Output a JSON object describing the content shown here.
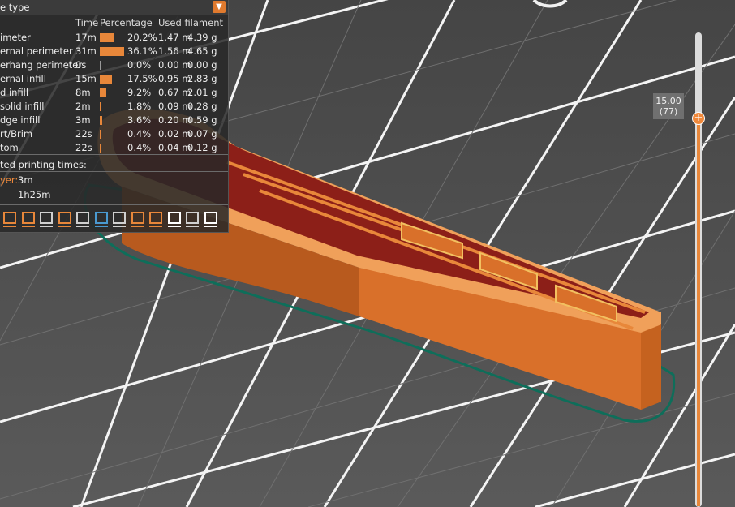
{
  "legend": {
    "title": "e type",
    "columns": {
      "time": "Time",
      "percentage": "Percentage",
      "used": "Used filament"
    },
    "rows": [
      {
        "name": "imeter",
        "time": "17m",
        "percent": 20.2,
        "percent_label": "20.2%",
        "length": "1.47 m",
        "weight": "4.39 g"
      },
      {
        "name": "ernal perimeter",
        "time": "31m",
        "percent": 36.1,
        "percent_label": "36.1%",
        "length": "1.56 m",
        "weight": "4.65 g"
      },
      {
        "name": "erhang perimeter",
        "time": "0s",
        "percent": 0.0,
        "percent_label": "0.0%",
        "length": "0.00 m",
        "weight": "0.00 g"
      },
      {
        "name": "ernal infill",
        "time": "15m",
        "percent": 17.5,
        "percent_label": "17.5%",
        "length": "0.95 m",
        "weight": "2.83 g"
      },
      {
        "name": "d infill",
        "time": "8m",
        "percent": 9.2,
        "percent_label": "9.2%",
        "length": "0.67 m",
        "weight": "2.01 g"
      },
      {
        "name": " solid infill",
        "time": "2m",
        "percent": 1.8,
        "percent_label": "1.8%",
        "length": "0.09 m",
        "weight": "0.28 g"
      },
      {
        "name": "dge infill",
        "time": "3m",
        "percent": 3.6,
        "percent_label": "3.6%",
        "length": "0.20 m",
        "weight": "0.59 g"
      },
      {
        "name": "rt/Brim",
        "time": "22s",
        "percent": 0.4,
        "percent_label": "0.4%",
        "length": "0.02 m",
        "weight": "0.07 g"
      },
      {
        "name": "tom",
        "time": "22s",
        "percent": 0.4,
        "percent_label": "0.4%",
        "length": "0.04 m",
        "weight": "0.12 g"
      }
    ],
    "estimated_title": "ted printing times:",
    "layer_label": "yer:",
    "layer_time": "3m",
    "total_time": "1h25m",
    "toolbar": [
      {
        "icon": "shell-icon",
        "color": "#e8873a"
      },
      {
        "icon": "overhang-icon",
        "color": "#e8873a"
      },
      {
        "icon": "wipe-icon",
        "color": "#d0d0d0"
      },
      {
        "icon": "seam-icon",
        "color": "#e8873a"
      },
      {
        "icon": "travel-icon",
        "color": "#d0d0d0"
      },
      {
        "icon": "color-change-icon",
        "color": "#4a9ad0"
      },
      {
        "icon": "timer-icon",
        "color": "#d0d0d0"
      },
      {
        "icon": "retraction-icon",
        "color": "#e8873a"
      },
      {
        "icon": "extruder-icon",
        "color": "#e8873a"
      },
      {
        "icon": "checker-icon",
        "color": "#ffffff"
      },
      {
        "icon": "cube-icon",
        "color": "#d0d0d0"
      },
      {
        "icon": "tool-marker-icon",
        "color": "#ffffff"
      }
    ]
  },
  "slider": {
    "value_label": "15.00",
    "layer_label": "(77)"
  },
  "colors": {
    "background": "#4d4d4d",
    "grid": "#ffffff",
    "part": "#e07a2e",
    "part_shade": "#a84e18",
    "infill": "#8c1f18",
    "brim": "#0e6e5a",
    "accent": "#e8873a"
  }
}
